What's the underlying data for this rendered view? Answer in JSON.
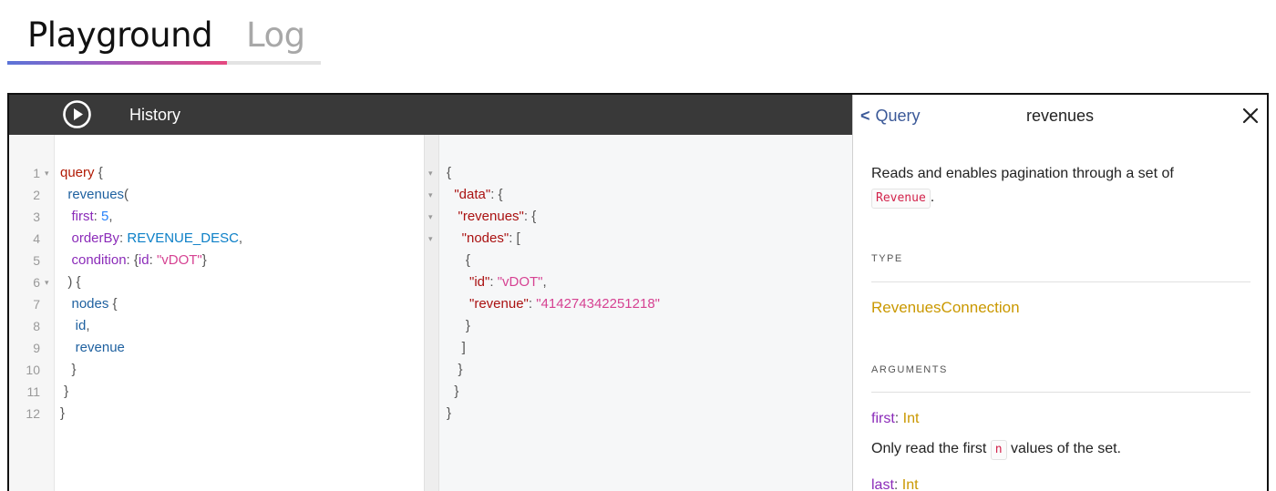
{
  "tabs": [
    {
      "label": "Playground",
      "active": true
    },
    {
      "label": "Log",
      "active": false
    }
  ],
  "toolbar": {
    "play_icon": "play-icon",
    "history_label": "History"
  },
  "editor": {
    "line_numbers": [
      "1",
      "2",
      "3",
      "4",
      "5",
      "6",
      "7",
      "8",
      "9",
      "10",
      "11",
      "12"
    ],
    "fold_markers": {
      "1": "▾",
      "6": "▾"
    },
    "lines": [
      [
        {
          "t": "query",
          "c": "kw"
        },
        {
          "t": " {",
          "c": "pun"
        }
      ],
      [
        {
          "t": "  revenues",
          "c": "fld"
        },
        {
          "t": "(",
          "c": "pun"
        }
      ],
      [
        {
          "t": "   first",
          "c": "arg"
        },
        {
          "t": ": ",
          "c": "pun"
        },
        {
          "t": "5",
          "c": "num"
        },
        {
          "t": ",",
          "c": "pun"
        }
      ],
      [
        {
          "t": "   orderBy",
          "c": "arg"
        },
        {
          "t": ": ",
          "c": "pun"
        },
        {
          "t": "REVENUE_DESC",
          "c": "enm"
        },
        {
          "t": ",",
          "c": "pun"
        }
      ],
      [
        {
          "t": "   condition",
          "c": "arg"
        },
        {
          "t": ": {",
          "c": "pun"
        },
        {
          "t": "id",
          "c": "arg"
        },
        {
          "t": ": ",
          "c": "pun"
        },
        {
          "t": "\"vDOT\"",
          "c": "str"
        },
        {
          "t": "}",
          "c": "pun"
        }
      ],
      [
        {
          "t": "  ) {",
          "c": "pun"
        }
      ],
      [
        {
          "t": "   nodes",
          "c": "fld"
        },
        {
          "t": " {",
          "c": "pun"
        }
      ],
      [
        {
          "t": "    id",
          "c": "fld"
        },
        {
          "t": ",",
          "c": "pun"
        }
      ],
      [
        {
          "t": "    revenue",
          "c": "fld"
        }
      ],
      [
        {
          "t": "   }",
          "c": "pun"
        }
      ],
      [
        {
          "t": " }",
          "c": "pun"
        }
      ],
      [
        {
          "t": "}",
          "c": "pun"
        }
      ]
    ]
  },
  "result": {
    "fold_markers": [
      "▾",
      "▾",
      "▾",
      "▾"
    ],
    "lines": [
      [
        {
          "t": "{",
          "c": "pun"
        }
      ],
      [
        {
          "t": "  ",
          "c": "pun"
        },
        {
          "t": "\"data\"",
          "c": "jkey"
        },
        {
          "t": ": {",
          "c": "pun"
        }
      ],
      [
        {
          "t": "   ",
          "c": "pun"
        },
        {
          "t": "\"revenues\"",
          "c": "jkey"
        },
        {
          "t": ": {",
          "c": "pun"
        }
      ],
      [
        {
          "t": "    ",
          "c": "pun"
        },
        {
          "t": "\"nodes\"",
          "c": "jkey"
        },
        {
          "t": ": [",
          "c": "pun"
        }
      ],
      [
        {
          "t": "     {",
          "c": "pun"
        }
      ],
      [
        {
          "t": "      ",
          "c": "pun"
        },
        {
          "t": "\"id\"",
          "c": "jkey"
        },
        {
          "t": ": ",
          "c": "pun"
        },
        {
          "t": "\"vDOT\"",
          "c": "str"
        },
        {
          "t": ",",
          "c": "pun"
        }
      ],
      [
        {
          "t": "      ",
          "c": "pun"
        },
        {
          "t": "\"revenue\"",
          "c": "jkey"
        },
        {
          "t": ": ",
          "c": "pun"
        },
        {
          "t": "\"414274342251218\"",
          "c": "str"
        }
      ],
      [
        {
          "t": "     }",
          "c": "pun"
        }
      ],
      [
        {
          "t": "    ]",
          "c": "pun"
        }
      ],
      [
        {
          "t": "   }",
          "c": "pun"
        }
      ],
      [
        {
          "t": "  }",
          "c": "pun"
        }
      ],
      [
        {
          "t": "}",
          "c": "pun"
        }
      ]
    ]
  },
  "docs": {
    "back_label": "Query",
    "title": "revenues",
    "close_icon": "close-icon",
    "description_prefix": "Reads and enables pagination through a set of",
    "description_code": "Revenue",
    "description_suffix": ".",
    "type_section": "TYPE",
    "type_name": "RevenuesConnection",
    "arguments_section": "ARGUMENTS",
    "arguments": [
      {
        "name": "first",
        "type": "Int",
        "desc_prefix": "Only read the first",
        "desc_code": "n",
        "desc_suffix": "values of the set."
      },
      {
        "name": "last",
        "type": "Int"
      }
    ]
  },
  "colors": {
    "toolbar_bg": "#393939",
    "keyword": "#b11a04",
    "field": "#1f61a0",
    "argument": "#8b2bb9",
    "number": "#2882f9",
    "enum": "#0b7fc7",
    "string": "#d64292",
    "type": "#ca9800",
    "link": "#3b5998"
  }
}
